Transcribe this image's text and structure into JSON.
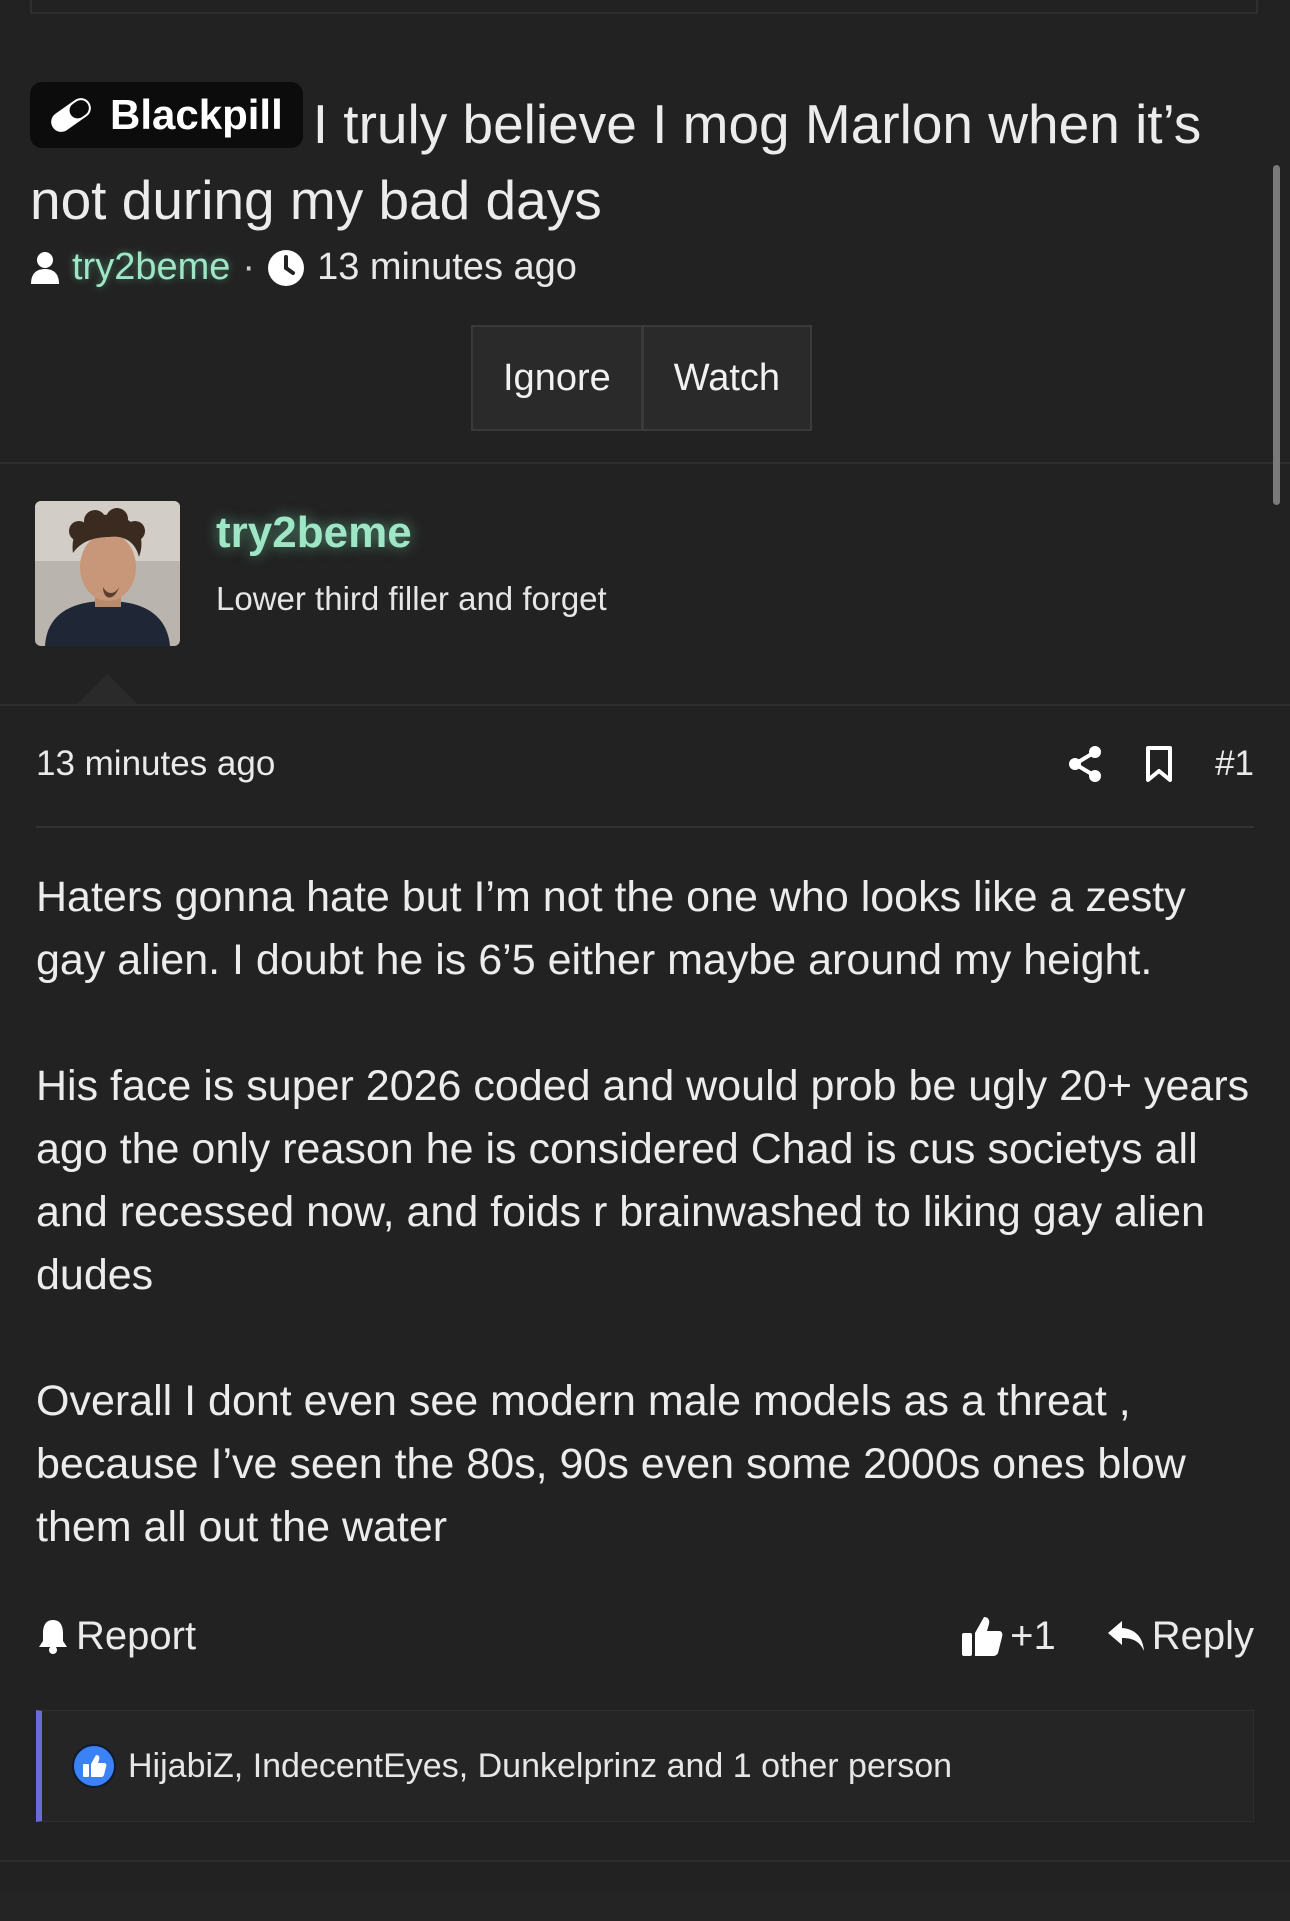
{
  "thread": {
    "prefix": "Blackpill",
    "title": "I truly believe I mog Marlon when it’s not during my bad days",
    "author": "try2beme",
    "separator": "·",
    "time": "13 minutes ago",
    "buttons": {
      "ignore": "Ignore",
      "watch": "Watch"
    }
  },
  "post": {
    "author": {
      "name": "try2beme",
      "user_title": "Lower third filler and forget",
      "name_color": "#9ee6c5"
    },
    "time": "13 minutes ago",
    "number": "#1",
    "icons": {
      "share": "share-icon",
      "bookmark": "bookmark-icon"
    },
    "body": [
      "Haters gonna hate but I’m not the one who looks like a zesty gay alien. I doubt he is 6’5 either maybe around my height.",
      "His face is super 2026 coded and would prob be ugly 20+ years ago the only reason he is considered Chad is cus societys all and recessed now, and foids r brainwashed to liking gay alien dudes",
      "Overall I dont even see modern male models as a threat , because I’ve seen the 80s, 90s even some 2000s ones blow them all out the water"
    ],
    "footer": {
      "report": "Report",
      "like": "+1",
      "reply": "Reply"
    },
    "reactions": "HijabiZ, IndecentEyes, Dunkelprinz and 1 other person"
  },
  "colors": {
    "background": "#222222",
    "accent_username": "#9ee6c5",
    "reaction_border": "#6a6ad8",
    "like_blue": "#3b82f6"
  }
}
